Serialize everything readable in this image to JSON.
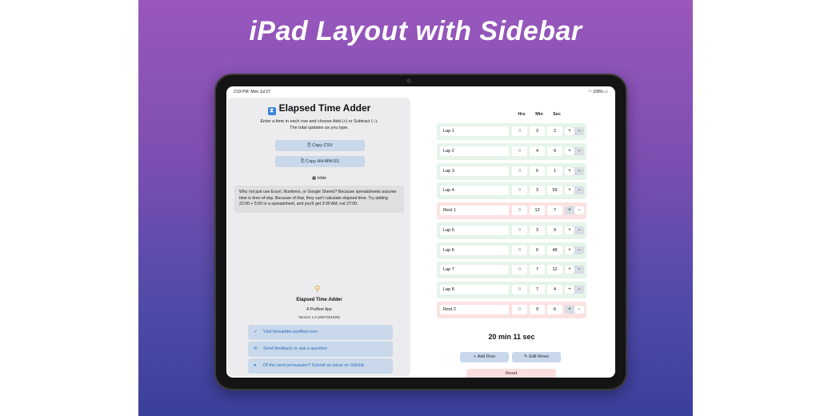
{
  "headline": "iPad Layout with Sidebar",
  "status": {
    "time": "2:03 PM",
    "date": "Mon Jul 27",
    "battery": "100%"
  },
  "sidebar": {
    "title": "Elapsed Time Adder",
    "intro": "Enter a time in each row and choose Add (+) or Subtract (−). The total updates as you type.",
    "copy_csv": "Copy CSV",
    "copy_hms": "Copy HH:MM:SS",
    "hide": "Hide",
    "note": "Why not just use Excel, Numbers, or Google Sheets? Because spreadsheets assume time is time-of-day. Because of that, they can't calculate elapsed time. Try adding 22:00 + 5:00 in a spreadsheet, and you'll get 3:00 AM, not 27:00.",
    "about_name": "Elapsed Time Adder",
    "about_sub": "A Podfeet App",
    "about_version": "Version 1.0 (2607251826)",
    "links": [
      {
        "label": "Visit timeadder.podfeet.com",
        "icon": "checkmark-circle-icon"
      },
      {
        "label": "Send feedback or ask a question",
        "icon": "envelope-icon"
      },
      {
        "label": "Of the nerd persuasion? Submit an issue on GitHub",
        "icon": "github-icon"
      }
    ]
  },
  "main": {
    "headers": {
      "hrs": "Hrs",
      "min": "Min",
      "sec": "Sec"
    },
    "rows": [
      {
        "name": "Lap 1",
        "hrs": "0",
        "min": "3",
        "sec": "2",
        "op": "add",
        "type": "lap"
      },
      {
        "name": "Lap 2",
        "hrs": "0",
        "min": "4",
        "sec": "9",
        "op": "add",
        "type": "lap"
      },
      {
        "name": "Lap 3",
        "hrs": "0",
        "min": "6",
        "sec": "1",
        "op": "add",
        "type": "lap"
      },
      {
        "name": "Lap 4",
        "hrs": "0",
        "min": "3",
        "sec": "59",
        "op": "add",
        "type": "lap"
      },
      {
        "name": "Rest 1",
        "hrs": "0",
        "min": "12",
        "sec": "7",
        "op": "subtract",
        "type": "rest"
      },
      {
        "name": "Lap 5",
        "hrs": "0",
        "min": "3",
        "sec": "9",
        "op": "add",
        "type": "lap"
      },
      {
        "name": "Lap 6",
        "hrs": "0",
        "min": "6",
        "sec": "48",
        "op": "add",
        "type": "lap"
      },
      {
        "name": "Lap 7",
        "hrs": "0",
        "min": "7",
        "sec": "12",
        "op": "add",
        "type": "lap"
      },
      {
        "name": "Lap 8",
        "hrs": "0",
        "min": "7",
        "sec": "4",
        "op": "add",
        "type": "lap"
      },
      {
        "name": "Rest 2",
        "hrs": "0",
        "min": "9",
        "sec": "6",
        "op": "subtract",
        "type": "rest"
      }
    ],
    "plus": "+",
    "minus": "−",
    "total": "20 min 11 sec",
    "add_row": "Add Row",
    "edit_rows": "Edit Rows",
    "reset": "Reset"
  },
  "colors": {
    "lap_row": "#e6f4ea",
    "rest_row": "#fbe2e2",
    "button": "#c9d8ea",
    "link": "#2b6fc2"
  }
}
